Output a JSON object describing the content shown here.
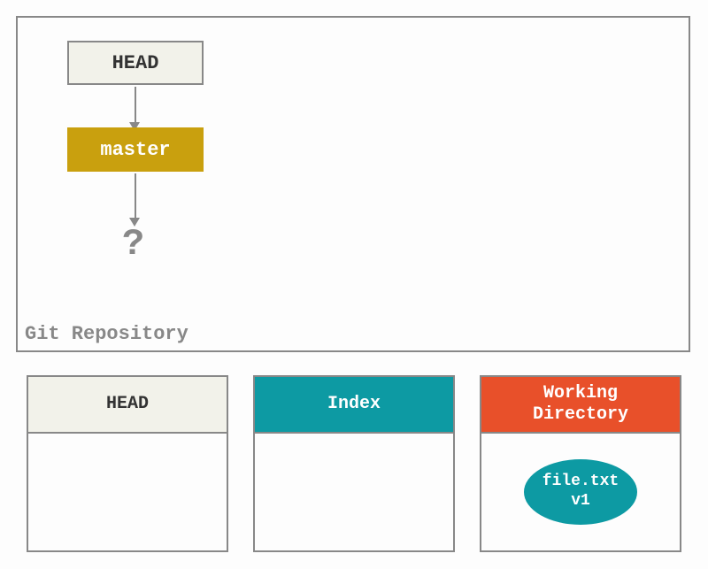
{
  "repo": {
    "label": "Git Repository",
    "head": "HEAD",
    "branch": "master",
    "pointer": "?"
  },
  "columns": {
    "head": {
      "label": "HEAD"
    },
    "index": {
      "label": "Index"
    },
    "workingDirectory": {
      "label": "Working\nDirectory",
      "file": {
        "name": "file.txt",
        "version": "v1"
      }
    }
  }
}
